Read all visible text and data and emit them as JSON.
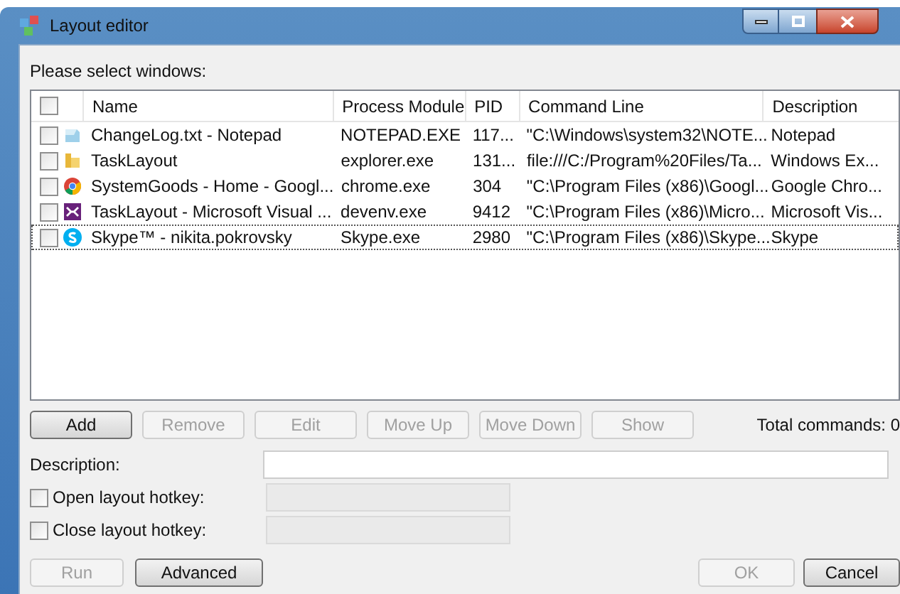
{
  "window": {
    "title": "Layout editor"
  },
  "prompt": {
    "label": "Please select windows:"
  },
  "table": {
    "header_checkbox": {
      "checked": false
    },
    "columns": [
      "Name",
      "Process Module",
      "PID",
      "Command Line",
      "Description"
    ],
    "rows": [
      {
        "checked": false,
        "focused": false,
        "cells": [
          "ChangeLog.txt - Notepad",
          "NOTEPAD.EXE",
          "117...",
          "\"C:\\Windows\\system32\\NOTE...",
          "Notepad"
        ]
      },
      {
        "checked": false,
        "focused": false,
        "cells": [
          "TaskLayout",
          "explorer.exe",
          "131...",
          "file:///C:/Program%20Files/Ta...",
          "Windows Ex..."
        ]
      },
      {
        "checked": false,
        "focused": false,
        "cells": [
          "SystemGoods - Home - Googl...",
          "chrome.exe",
          "304",
          "\"C:\\Program Files (x86)\\Googl...",
          "Google Chro..."
        ]
      },
      {
        "checked": false,
        "focused": false,
        "cells": [
          "TaskLayout - Microsoft Visual ...",
          "devenv.exe",
          "9412",
          "\"C:\\Program Files (x86)\\Micro...",
          "Microsoft Vis..."
        ]
      },
      {
        "checked": false,
        "focused": true,
        "cells": [
          "Skype™ - nikita.pokrovsky",
          "Skype.exe",
          "2980",
          "\"C:\\Program Files (x86)\\Skype...",
          "Skype"
        ]
      }
    ]
  },
  "list_buttons": [
    {
      "label": "Add",
      "disabled": false
    },
    {
      "label": "Remove",
      "disabled": true
    },
    {
      "label": "Edit",
      "disabled": true
    },
    {
      "label": "Move Up",
      "disabled": true
    },
    {
      "label": "Move Down",
      "disabled": true
    },
    {
      "label": "Show",
      "disabled": true
    }
  ],
  "total_commands": "Total commands: 0",
  "description": {
    "label": "Description:"
  },
  "hotkeys": [
    {
      "label": "Open layout hotkey:",
      "checked": false,
      "disabled": true
    },
    {
      "label": "Close layout hotkey:",
      "checked": false,
      "disabled": true
    }
  ],
  "left_buttons": [
    {
      "label": "Run",
      "disabled": true
    },
    {
      "label": "Advanced",
      "disabled": false
    }
  ],
  "right_buttons": [
    {
      "label": "OK",
      "disabled": true
    },
    {
      "label": "Cancel",
      "disabled": false
    }
  ]
}
